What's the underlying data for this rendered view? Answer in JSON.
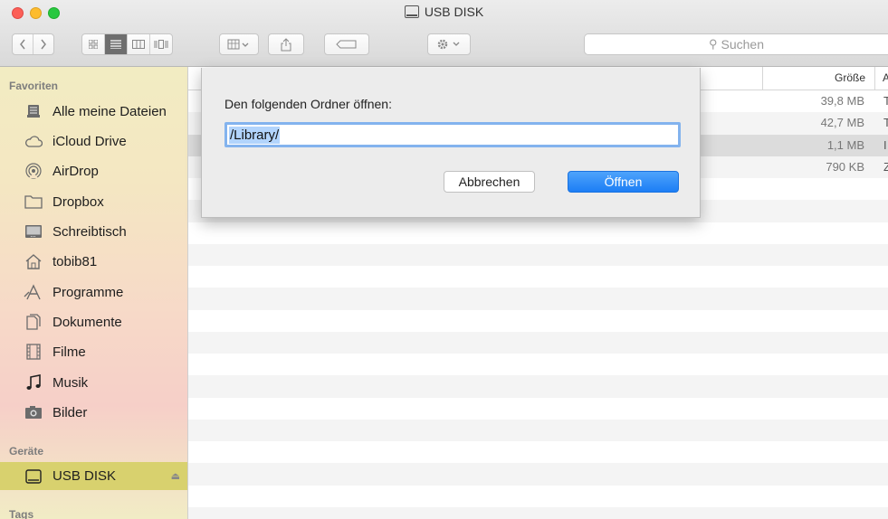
{
  "window": {
    "title": "USB DISK"
  },
  "toolbar": {
    "search_placeholder": "Suchen",
    "icons": [
      "back-icon",
      "forward-icon",
      "icon-view-icon",
      "list-view-icon",
      "column-view-icon",
      "cover-flow-icon",
      "arrange-icon",
      "share-icon",
      "tag-icon",
      "action-gear-icon"
    ]
  },
  "sidebar": {
    "favorites_heading": "Favoriten",
    "favorites": [
      {
        "label": "Alle meine Dateien",
        "icon": "all-files-icon"
      },
      {
        "label": "iCloud Drive",
        "icon": "cloud-icon"
      },
      {
        "label": "AirDrop",
        "icon": "airdrop-icon"
      },
      {
        "label": "Dropbox",
        "icon": "folder-icon"
      },
      {
        "label": "Schreibtisch",
        "icon": "desktop-icon"
      },
      {
        "label": "tobib81",
        "icon": "home-icon"
      },
      {
        "label": "Programme",
        "icon": "applications-icon"
      },
      {
        "label": "Dokumente",
        "icon": "documents-icon"
      },
      {
        "label": "Filme",
        "icon": "movies-icon"
      },
      {
        "label": "Musik",
        "icon": "music-icon"
      },
      {
        "label": "Bilder",
        "icon": "pictures-icon"
      }
    ],
    "devices_heading": "Geräte",
    "devices": [
      {
        "label": "USB DISK",
        "icon": "disk-icon",
        "selected": true
      }
    ],
    "tags_heading": "Tags"
  },
  "list": {
    "size_header": "Größe",
    "more_header": "A",
    "rows": [
      {
        "size": "39,8 MB",
        "extra": "T"
      },
      {
        "size": "42,7 MB",
        "extra": "T"
      },
      {
        "size": "1,1 MB",
        "extra": "I"
      },
      {
        "size": "790 KB",
        "extra": "Z"
      }
    ]
  },
  "dialog": {
    "prompt": "Den folgenden Ordner öffnen:",
    "path_value": "/Library/",
    "cancel_label": "Abbrechen",
    "open_label": "Öffnen"
  },
  "colors": {
    "accent_blue": "#1c7ef5",
    "selection_yellow": "#d8d16e"
  }
}
